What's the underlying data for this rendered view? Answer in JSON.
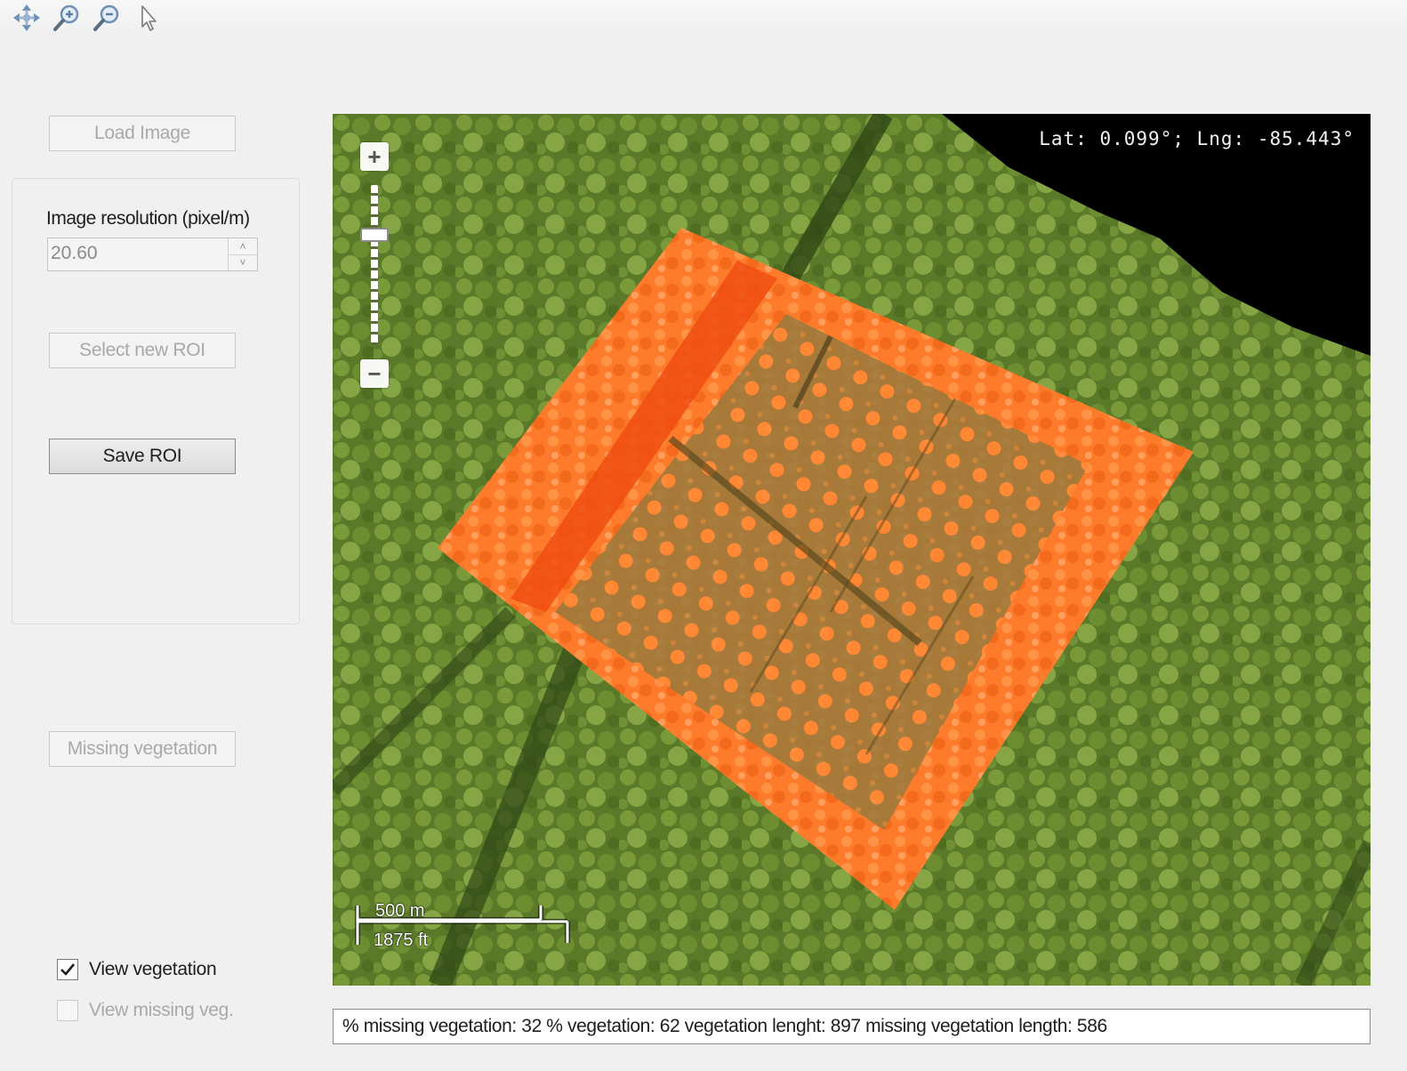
{
  "toolbar": {
    "tools": [
      {
        "icon": "pan-icon"
      },
      {
        "icon": "zoom-in-icon"
      },
      {
        "icon": "zoom-out-icon"
      },
      {
        "icon": "pointer-icon"
      }
    ]
  },
  "controls": {
    "load_image": "Load Image",
    "resolution_label": "Image resolution (pixel/m)",
    "resolution_value": "20.60",
    "spin_up": "˄",
    "spin_down": "˅",
    "select_roi": "Select new ROI",
    "save_roi": "Save ROI",
    "missing_vegetation": "Missing vegetation",
    "view_vegetation": {
      "label": "View vegetation",
      "checked": true
    },
    "view_missing": {
      "label": "View missing veg.",
      "checked": false
    }
  },
  "map": {
    "coords": "Lat: 0.099°; Lng: -85.443°",
    "zoom_in": "+",
    "zoom_out": "−",
    "scale_m": "500 m",
    "scale_ft": "1875 ft",
    "colors": {
      "vegetation": "#5d7f2c",
      "overlay": "#ff7a2e",
      "void": "#000000"
    }
  },
  "status": {
    "text": "% missing vegetation: 32 % vegetation: 62 vegetation lenght: 897 missing vegetation length: 586"
  }
}
